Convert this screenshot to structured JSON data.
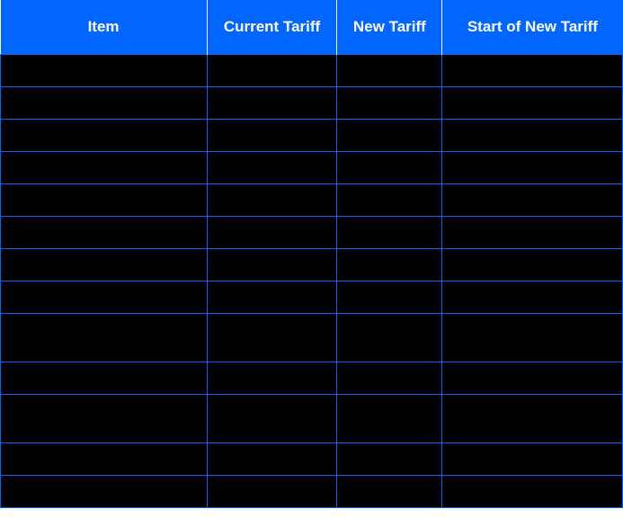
{
  "chart_data": {
    "type": "table",
    "title": "",
    "columns": [
      "Item",
      "Current Tariff",
      "New Tariff",
      "Start of New Tariff"
    ],
    "rows": [
      [
        "",
        "",
        "",
        ""
      ],
      [
        "",
        "",
        "",
        ""
      ],
      [
        "",
        "",
        "",
        ""
      ],
      [
        "",
        "",
        "",
        ""
      ],
      [
        "",
        "",
        "",
        ""
      ],
      [
        "",
        "",
        "",
        ""
      ],
      [
        "",
        "",
        "",
        ""
      ],
      [
        "",
        "",
        "",
        ""
      ],
      [
        "",
        "",
        "",
        ""
      ],
      [
        "",
        "",
        "",
        ""
      ],
      [
        "",
        "",
        "",
        ""
      ],
      [
        "",
        "",
        "",
        ""
      ],
      [
        "",
        "",
        "",
        ""
      ]
    ],
    "row_heights": [
      "normal",
      "normal",
      "normal",
      "normal",
      "normal",
      "normal",
      "normal",
      "normal",
      "tall",
      "normal",
      "tall",
      "normal",
      "normal"
    ]
  },
  "headers": {
    "item": "Item",
    "current": "Current Tariff",
    "new": "New Tariff",
    "start": "Start of New Tariff"
  }
}
